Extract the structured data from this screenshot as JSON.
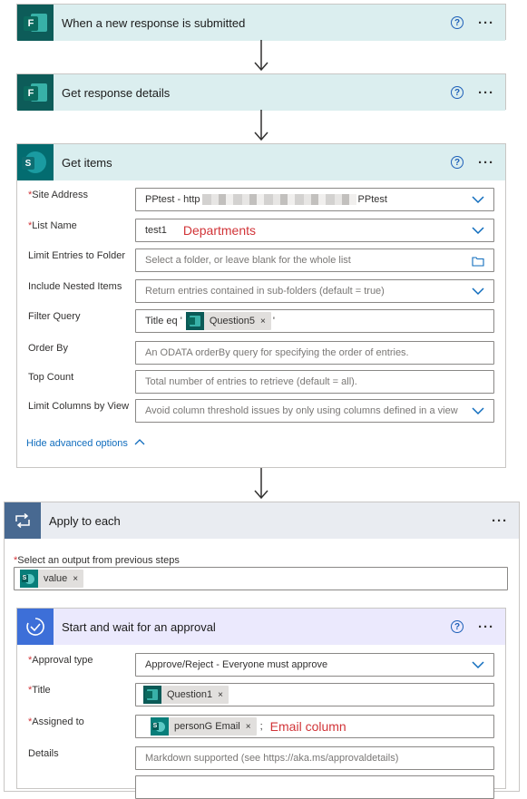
{
  "steps": {
    "trigger": {
      "title": "When a new response is submitted",
      "help": "?",
      "more": "···"
    },
    "response": {
      "title": "Get response details",
      "help": "?",
      "more": "···"
    },
    "get_items": {
      "title": "Get items",
      "help": "?",
      "more": "···",
      "site_address": {
        "label": "Site Address",
        "value_prefix": "PPtest - http",
        "value_suffix": "PPtest"
      },
      "list_name": {
        "label": "List Name",
        "value": "test1",
        "annotation": "Departments"
      },
      "limit_folder": {
        "label": "Limit Entries to Folder",
        "placeholder": "Select a folder, or leave blank for the whole list"
      },
      "nested": {
        "label": "Include Nested Items",
        "placeholder": "Return entries contained in sub-folders (default = true)"
      },
      "filter": {
        "label": "Filter Query",
        "prefix": "Title eq '",
        "token": "Question5",
        "suffix": "'"
      },
      "order_by": {
        "label": "Order By",
        "placeholder": "An ODATA orderBy query for specifying the order of entries."
      },
      "top_count": {
        "label": "Top Count",
        "placeholder": "Total number of entries to retrieve (default = all)."
      },
      "limit_view": {
        "label": "Limit Columns by View",
        "placeholder": "Avoid column threshold issues by only using columns defined in a view"
      },
      "hide_advanced": "Hide advanced options"
    },
    "apply_each": {
      "title": "Apply to each",
      "more": "···",
      "select_label": "Select an output from previous steps",
      "token": "value"
    },
    "approval": {
      "title": "Start and wait for an approval",
      "help": "?",
      "more": "···",
      "type": {
        "label": "Approval type",
        "value": "Approve/Reject - Everyone must approve"
      },
      "title_field": {
        "label": "Title",
        "token": "Question1"
      },
      "assigned": {
        "label": "Assigned to",
        "token": "personG Email",
        "suffix": ";",
        "annotation": "Email column"
      },
      "details": {
        "label": "Details",
        "placeholder": "Markdown supported (see https://aka.ms/approvaldetails)"
      }
    }
  },
  "required_marker": "*",
  "remove_glyph": "×"
}
